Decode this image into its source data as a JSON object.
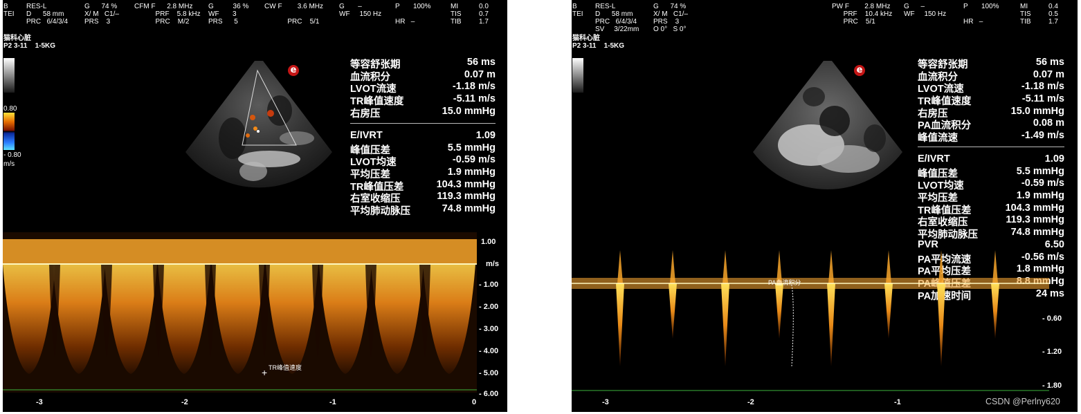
{
  "left": {
    "header": {
      "c1": "B\nTEI",
      "c2": "RES-L\nD      58 mm\nPRC   6/4/3/4",
      "c3": "G      74 %\nX/ M   C1/–\nPRS    3",
      "c4": "CFM F      2.8 MHz\n           PRF    5.8 kHz\n           PRC    M/2",
      "c5": "G          36 %\nWF       3\nPRS      5",
      "c6": "CW F        3.6 MHz\n\n            PRC    5/1",
      "c7": "G       –\nWF     150 Hz",
      "c8": "P       100%\n\nHR   –",
      "c9": "MI\nTIS\nTIB",
      "c10": "0.0\n0.7\n1.7"
    },
    "patient": "猫科心脏\nP2 3-11    1-5KG",
    "color_scale": {
      "top": "0.80",
      "bottom": "- 0.80",
      "unit": "m/s"
    },
    "logo": "e",
    "measurements_a": [
      {
        "label": "等容舒张期",
        "value": "56 ms"
      },
      {
        "label": "血流积分",
        "value": "0.07 m"
      },
      {
        "label": "LVOT流速",
        "value": "-1.18 m/s"
      },
      {
        "label": "TR峰值速度",
        "value": "-5.11 m/s"
      },
      {
        "label": "右房压",
        "value": "15.0 mmHg"
      }
    ],
    "measurements_b": [
      {
        "label": "E/IVRT",
        "value": "1.09"
      },
      {
        "label": "峰值压差",
        "value": "5.5 mmHg"
      },
      {
        "label": "LVOT均速",
        "value": "-0.59 m/s"
      },
      {
        "label": "平均压差",
        "value": "1.9 mmHg"
      },
      {
        "label": "TR峰值压差",
        "value": "104.3 mmHg"
      },
      {
        "label": "右室收缩压",
        "value": "119.3 mmHg"
      },
      {
        "label": "平均肺动脉压",
        "value": "74.8 mmHg"
      }
    ],
    "velocity_ticks": [
      "1.00",
      "m/s",
      "- 1.00",
      "- 2.00",
      "- 3.00",
      "- 4.00",
      "- 5.00",
      "- 6.00"
    ],
    "time_ticks": [
      "-3",
      "-2",
      "-1",
      "0"
    ],
    "annotation": "TR峰值速度"
  },
  "right": {
    "header": {
      "c1": "B\nTEI\n\n",
      "c2": "RES-L\nD      58 mm\nPRC   6/4/3/4\nSV     3/22mm",
      "c3": "G      74 %\nX/ M   C1/–\nPRS    3\nO 0°   S 0°",
      "c4": "PW F        2.8 MHz\n      PRF    10.4 kHz\n      PRC    5/1",
      "c5": "G      –\nWF     150 Hz",
      "c8": "P       100%\n\nHR   –",
      "c9": "MI\nTIS\nTIB",
      "c10": "0.4\n0.5\n1.7"
    },
    "patient": "猫科心脏\nP2 3-11    1-5KG",
    "logo": "e",
    "measurements_a": [
      {
        "label": "等容舒张期",
        "value": "56 ms"
      },
      {
        "label": "血流积分",
        "value": "0.07 m"
      },
      {
        "label": "LVOT流速",
        "value": "-1.18 m/s"
      },
      {
        "label": "TR峰值速度",
        "value": "-5.11 m/s"
      },
      {
        "label": "右房压",
        "value": "15.0 mmHg"
      },
      {
        "label": "PA血流积分",
        "value": "0.08 m"
      },
      {
        "label": "峰值流速",
        "value": "-1.49 m/s"
      }
    ],
    "measurements_b": [
      {
        "label": "E/IVRT",
        "value": "1.09"
      },
      {
        "label": "峰值压差",
        "value": "5.5 mmHg"
      },
      {
        "label": "LVOT均速",
        "value": "-0.59 m/s"
      },
      {
        "label": "平均压差",
        "value": "1.9 mmHg"
      },
      {
        "label": "TR峰值压差",
        "value": "104.3 mmHg"
      },
      {
        "label": "右室收缩压",
        "value": "119.3 mmHg"
      },
      {
        "label": "平均肺动脉压",
        "value": "74.8 mmHg"
      },
      {
        "label": "PVR",
        "value": "6.50"
      },
      {
        "label": "PA平均流速",
        "value": "-0.56 m/s"
      },
      {
        "label": "PA平均压差",
        "value": "1.8 mmHg"
      },
      {
        "label": "PA峰值压差",
        "value": "8.8 mmHg"
      },
      {
        "label": "PA加速时间",
        "value": "24 ms"
      }
    ],
    "velocity_ticks": [
      "- 0.60",
      "- 1.20",
      "- 1.80"
    ],
    "time_ticks": [
      "-3",
      "-2",
      "-1"
    ],
    "annotation": "PA血流积分"
  },
  "watermark": "CSDN @Perlny620"
}
